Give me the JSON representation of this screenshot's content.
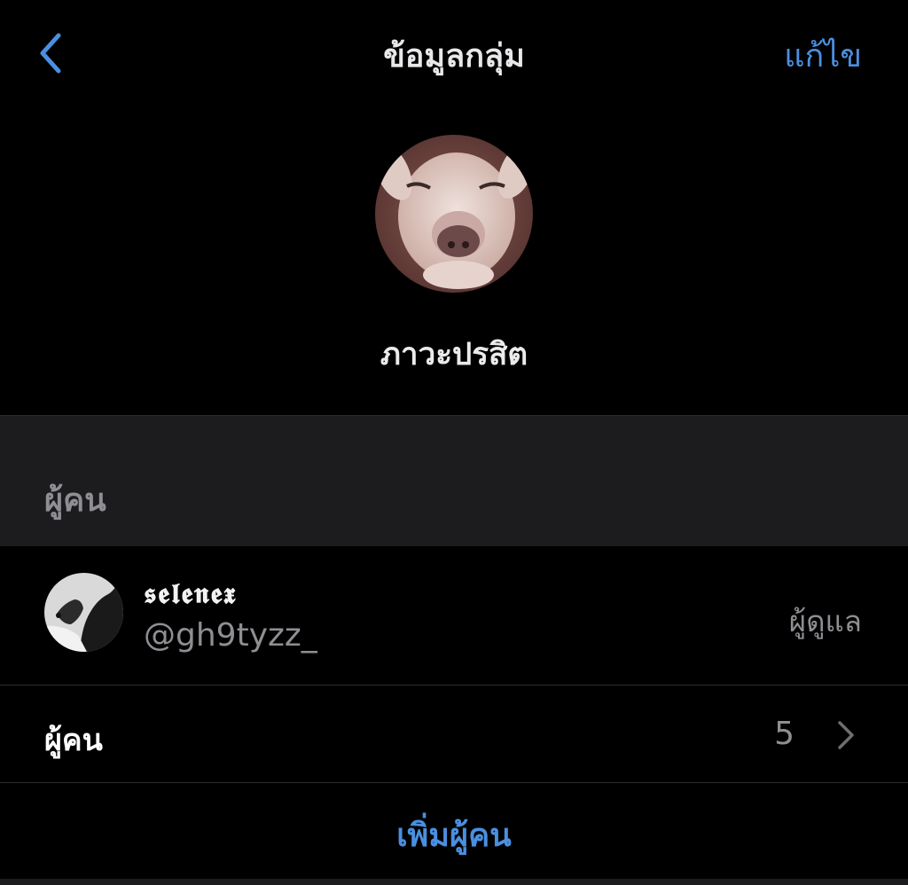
{
  "navbar": {
    "back_icon": "chevron-left-icon",
    "title": "ข้อมูลกลุ่ม",
    "edit_label": "แก้ไข"
  },
  "group": {
    "avatar_icon": "group-avatar-dog-photo",
    "name": "ภาวะปรสิต"
  },
  "section": {
    "title": "ผู้คน"
  },
  "members": [
    {
      "display_name": "𝖘𝖊𝖑𝖊𝖓𝖊𝖝",
      "handle": "@gh9tyzz_",
      "role": "ผู้ดูแล",
      "avatar_icon": "member-avatar-photo"
    }
  ],
  "people_row": {
    "label": "ผู้คน",
    "count": "5",
    "chevron_icon": "chevron-right-icon"
  },
  "add_people": {
    "label": "เพิ่มผู้คน"
  },
  "colors": {
    "background": "#000000",
    "accent": "#4a8fe0",
    "secondary_text": "#8e8e93",
    "section_bg": "#1c1c1f"
  }
}
